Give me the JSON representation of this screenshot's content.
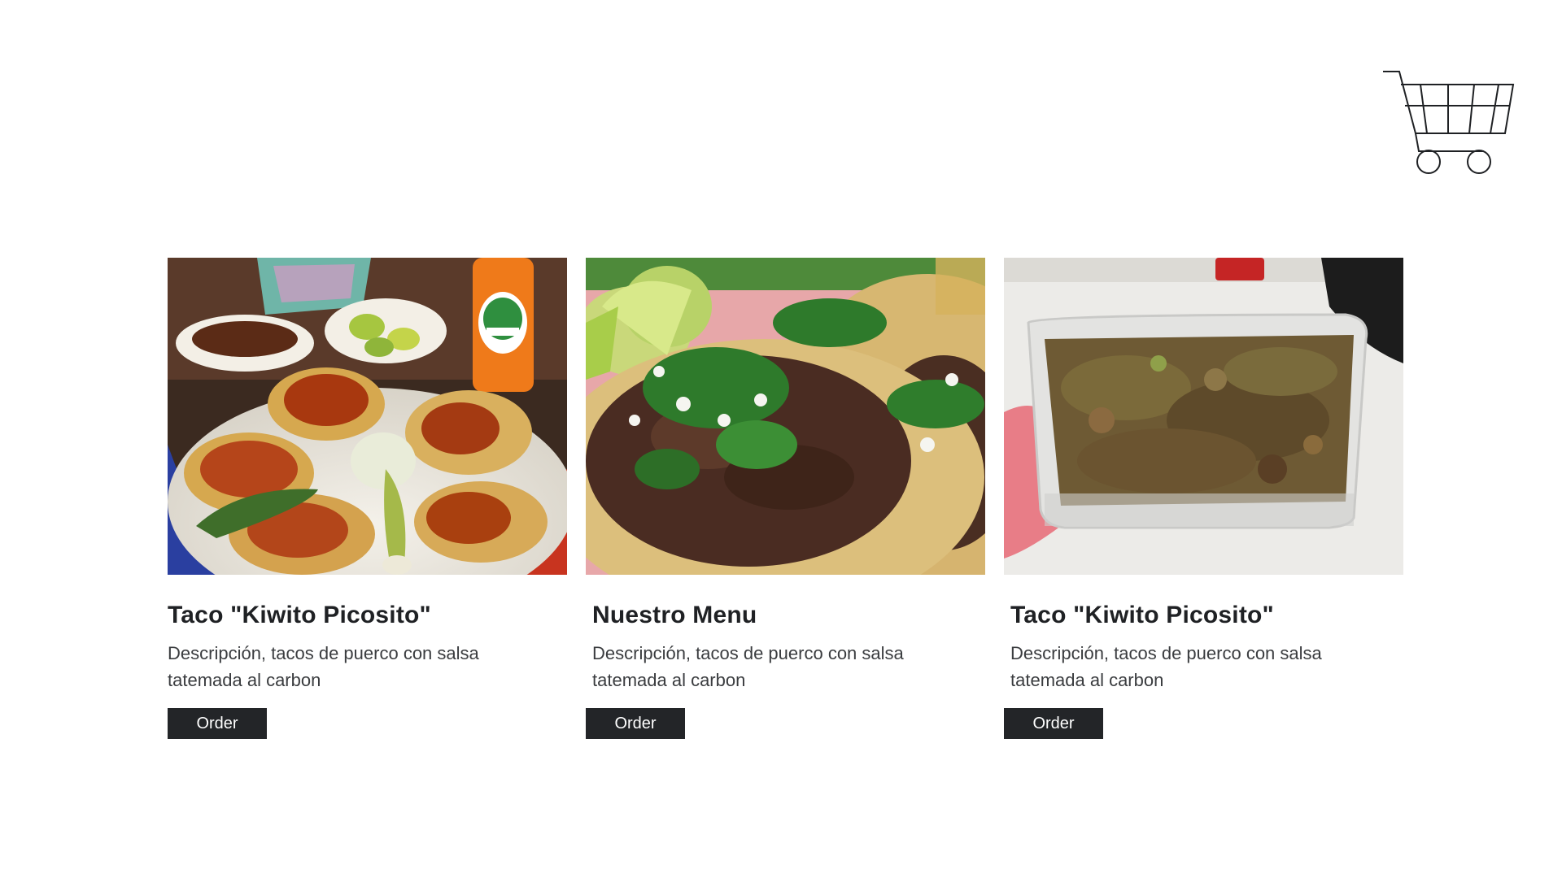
{
  "cart": {
    "icon": "shopping-cart-icon"
  },
  "colors": {
    "button_bg": "#232528",
    "button_text": "#ffffff",
    "title": "#1f2124",
    "body_text": "#3a3c3f"
  },
  "products": [
    {
      "image": "tacos-al-pastor-with-jarritos-mandarin",
      "title": "Taco \"Kiwito Picosito\"",
      "description": "Descripción, tacos de puerco con salsa tatemada al carbon",
      "button_label": "Order"
    },
    {
      "image": "carne-asada-tacos-with-cilantro-onion-lime",
      "title": "Nuestro Menu",
      "description": "Descripción, tacos de puerco con salsa tatemada al carbon",
      "button_label": "Order"
    },
    {
      "image": "seasoned-pork-in-plastic-container",
      "title": "Taco \"Kiwito Picosito\"",
      "description": "Descripción, tacos de puerco con salsa tatemada al carbon",
      "button_label": "Order"
    }
  ]
}
